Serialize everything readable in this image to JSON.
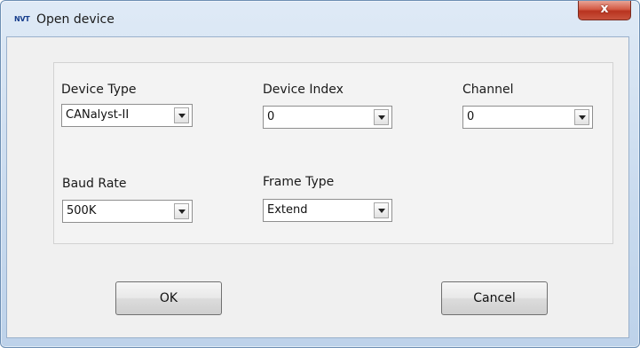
{
  "window": {
    "title": "Open device",
    "app_logo": "NVT",
    "close_glyph": "x"
  },
  "fields": {
    "device_type": {
      "label": "Device Type",
      "value": "CANalyst-II"
    },
    "device_index": {
      "label": "Device Index",
      "value": "0"
    },
    "channel": {
      "label": "Channel",
      "value": "0"
    },
    "baud_rate": {
      "label": "Baud Rate",
      "value": "500K"
    },
    "frame_type": {
      "label": "Frame Type",
      "value": "Extend"
    }
  },
  "buttons": {
    "ok": "OK",
    "cancel": "Cancel"
  },
  "icons": {
    "dropdown": "chevron-down-icon",
    "close": "close-icon",
    "logo": "app-logo-icon"
  },
  "colors": {
    "title_bar": "#c8daee",
    "close_button": "#c94a36",
    "client_area": "#f0f0f0"
  }
}
